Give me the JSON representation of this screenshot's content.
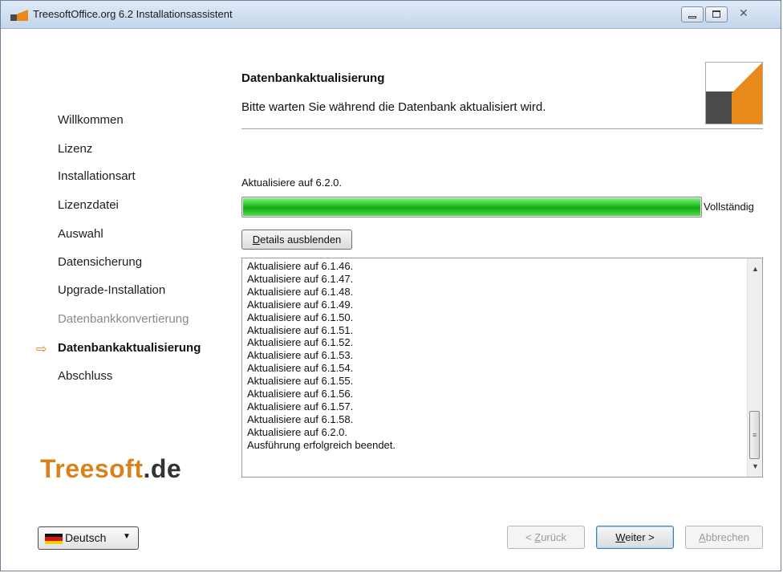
{
  "window": {
    "title": "TreesoftOffice.org 6.2 Installationsassistent",
    "close_glyph": "✕"
  },
  "sidebar": {
    "steps": [
      {
        "label": "Willkommen",
        "state": "normal"
      },
      {
        "label": "Lizenz",
        "state": "normal"
      },
      {
        "label": "Installationsart",
        "state": "normal"
      },
      {
        "label": "Lizenzdatei",
        "state": "normal"
      },
      {
        "label": "Auswahl",
        "state": "normal"
      },
      {
        "label": "Datensicherung",
        "state": "normal"
      },
      {
        "label": "Upgrade-Installation",
        "state": "normal"
      },
      {
        "label": "Datenbankkonvertierung",
        "state": "disabled"
      },
      {
        "label": "Datenbankaktualisierung",
        "state": "current"
      },
      {
        "label": "Abschluss",
        "state": "normal"
      }
    ],
    "current_marker": "⇨",
    "brand": {
      "name": "Treesoft",
      "tld": ".de"
    }
  },
  "header": {
    "title": "Datenbankaktualisierung",
    "subtitle": "Bitte warten Sie während die Datenbank aktualisiert wird."
  },
  "progress": {
    "label": "Aktualisiere auf 6.2.0.",
    "value_percent": 100,
    "status": "Vollständig",
    "color": "#12a812"
  },
  "details_button": {
    "mnemonic": "D",
    "label_rest": "etails ausblenden"
  },
  "log": {
    "lines": [
      "Aktualisiere auf 6.1.46.",
      "Aktualisiere auf 6.1.47.",
      "Aktualisiere auf 6.1.48.",
      "Aktualisiere auf 6.1.49.",
      "Aktualisiere auf 6.1.50.",
      "Aktualisiere auf 6.1.51.",
      "Aktualisiere auf 6.1.52.",
      "Aktualisiere auf 6.1.53.",
      "Aktualisiere auf 6.1.54.",
      "Aktualisiere auf 6.1.55.",
      "Aktualisiere auf 6.1.56.",
      "Aktualisiere auf 6.1.57.",
      "Aktualisiere auf 6.1.58.",
      "Aktualisiere auf 6.2.0.",
      "Ausführung erfolgreich beendet."
    ]
  },
  "language": {
    "selected": "Deutsch",
    "flag_icon": "german-flag-icon"
  },
  "footer": {
    "back": {
      "prefix": "< ",
      "mnemonic": "Z",
      "rest": "urück"
    },
    "next": {
      "mnemonic": "W",
      "rest": "eiter >"
    },
    "cancel": {
      "mnemonic": "A",
      "rest": "bbrechen"
    }
  },
  "colors": {
    "accent": "#e88a1a",
    "brand_dark": "#4a4a4a"
  }
}
